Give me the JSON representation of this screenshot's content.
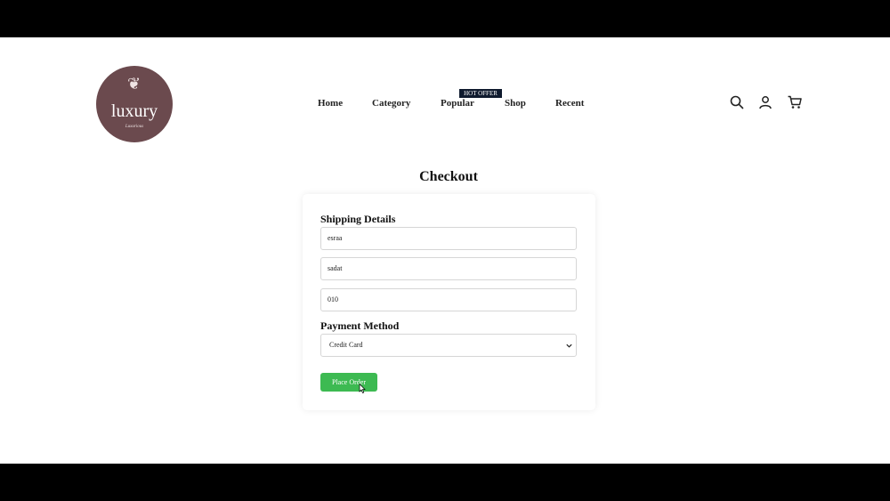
{
  "logo": {
    "text": "luxury",
    "subtext": "Luxurious",
    "ornament": "❦"
  },
  "nav": {
    "items": [
      "Home",
      "Category",
      "Popular",
      "Shop",
      "Recent"
    ],
    "badge": "HOT OFFER"
  },
  "header_icons": [
    "search-icon",
    "user-icon",
    "cart-icon"
  ],
  "page": {
    "title": "Checkout"
  },
  "shipping": {
    "heading": "Shipping Details",
    "first_name": "esraa",
    "last_name": "sadat",
    "phone": "010"
  },
  "payment": {
    "heading": "Payment Method",
    "selected": "Credit Card"
  },
  "actions": {
    "place_order": "Place Order"
  },
  "colors": {
    "logo_bg": "#6b4a4e",
    "button_bg": "#3dba52",
    "badge_bg": "#0f1a2e"
  }
}
